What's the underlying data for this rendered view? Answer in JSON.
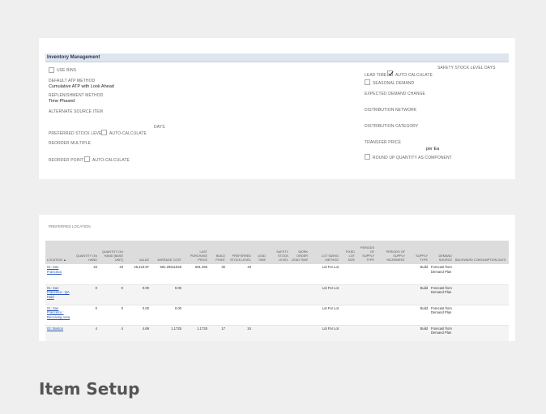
{
  "panel": {
    "title": "Inventory Management",
    "use_bins": "USE BINS",
    "default_atp_label": "DEFAULT ATP METHOD",
    "default_atp_value": "Cumulative ATP with Look Ahead",
    "replenishment_label": "REPLENISHMENT METHOD",
    "replenishment_value": "Time Phased",
    "alt_source_label": "ALTERNATE SOURCE ITEM",
    "days_label": "DAYS",
    "preferred_stock_label": "PREFERRED STOCK LEVEL",
    "auto_calc_1": "AUTO-CALCULATE",
    "reorder_multiple_label": "REORDER MULTIPLE",
    "reorder_point_label": "REORDER POINT",
    "auto_calc_2": "AUTO-CALCULATE",
    "safety_stock_days_label": "SAFETY STOCK LEVEL DAYS",
    "lead_time_label": "LEAD TIME",
    "auto_calc_3": "AUTO-CALCULATE",
    "seasonal_demand": "SEASONAL DEMAND",
    "expected_demand_label": "EXPECTED DEMAND CHANGE",
    "distribution_network_label": "DISTRIBUTION NETWORK",
    "distribution_category_label": "DISTRIBUTION CATEGORY",
    "transfer_price_label": "TRANSFER PRICE",
    "transfer_price_unit": "per Ea",
    "round_up_label": "ROUND UP QUANTITY AS COMPONENT"
  },
  "locations": {
    "title": "PREFERRED LOCATION",
    "columns": [
      "LOCATION ▲",
      "QUANTITY ON HAND",
      "QUANTITY ON HAND (BASE UNIT)",
      "VALUE",
      "AVERAGE COST",
      "LAST PURCHASE PRICE",
      "BUILD POINT",
      "PREFERRED STOCK LEVEL",
      "LEAD TIME",
      "SAFETY STOCK LEVEL",
      "WORK ORDER LEAD TIME",
      "LOT SIZING METHOD",
      "FIXED LOT SIZE",
      "PERIODS OF SUPPLY TYPE",
      "PERIODS OF SUPPLY INCREMENT",
      "SUPPLY TYPE",
      "DEMAND SOURCE",
      "BACKWARD CONSUMPTION DAYS"
    ],
    "rows": [
      {
        "location": "01: San Francisco",
        "qoh": "43",
        "qoh_base": "43",
        "value": "25,423.97",
        "avg_cost": "591.25511628",
        "last_price": "591.255",
        "build_point": "30",
        "pref_stock": "43",
        "lot_method": "Lot For Lot",
        "supply_type": "Build",
        "demand_source": "Forecast from Demand Plan"
      },
      {
        "location": "01: San Francisco : QA Hold",
        "qoh": "0",
        "qoh_base": "0",
        "value": "0.00",
        "avg_cost": "0.00",
        "last_price": "",
        "build_point": "",
        "pref_stock": "",
        "lot_method": "Lot For Lot",
        "supply_type": "Build",
        "demand_source": "Forecast from Demand Plan"
      },
      {
        "location": "01: San Francisco : Receiving Area",
        "qoh": "0",
        "qoh_base": "0",
        "value": "0.00",
        "avg_cost": "0.00",
        "last_price": "",
        "build_point": "",
        "pref_stock": "",
        "lot_method": "Lot For Lot",
        "supply_type": "Build",
        "demand_source": "Forecast from Demand Plan"
      },
      {
        "location": "02: Boston",
        "qoh": "4",
        "qoh_base": "4",
        "value": "4.69",
        "avg_cost": "1.1725",
        "last_price": "1.1725",
        "build_point": "17",
        "pref_stock": "24",
        "lot_method": "Lot For Lot",
        "supply_type": "Build",
        "demand_source": "Forecast from Demand Plan"
      }
    ]
  },
  "caption": "Item Setup"
}
